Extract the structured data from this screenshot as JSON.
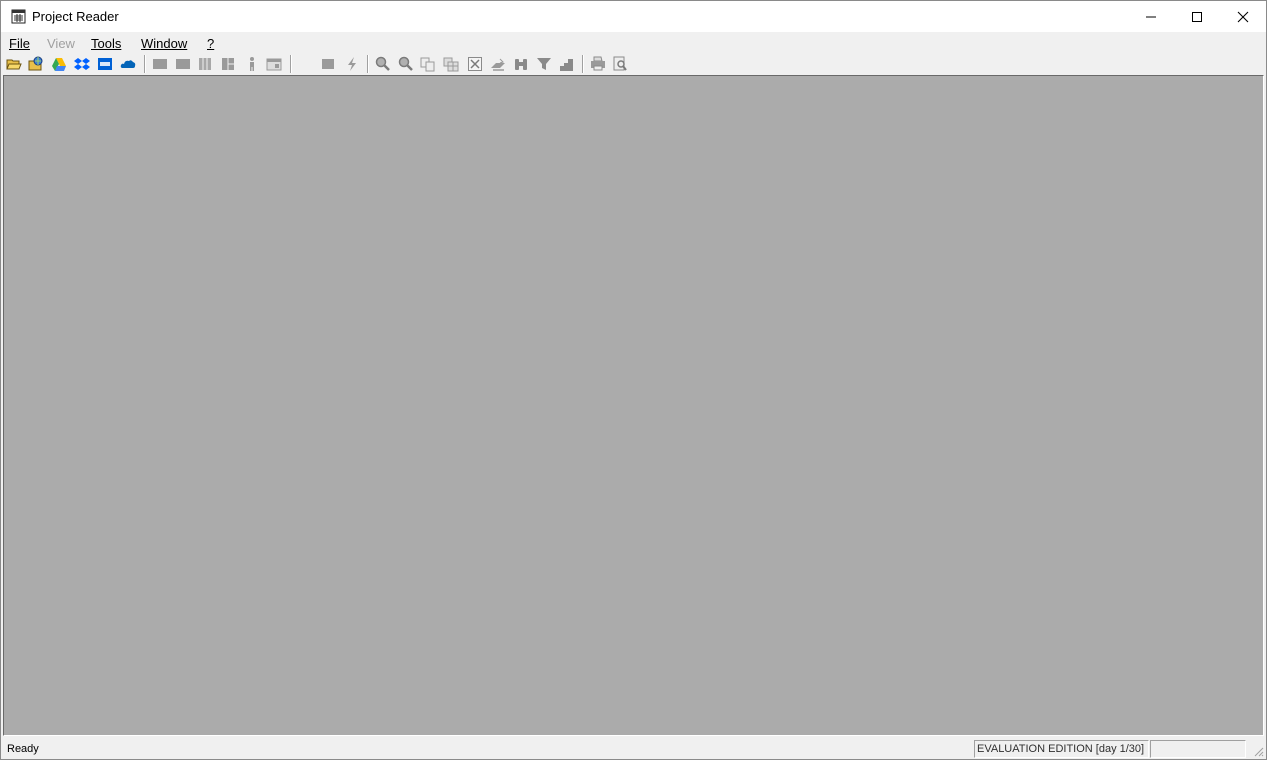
{
  "window": {
    "title": "Project Reader"
  },
  "menu": [
    {
      "label": "File",
      "enabled": true
    },
    {
      "label": "View",
      "enabled": false
    },
    {
      "label": "Tools",
      "enabled": true
    },
    {
      "label": "Window",
      "enabled": true
    },
    {
      "label": "?",
      "enabled": true
    }
  ],
  "toolbar_icons": [
    "open-folder-icon",
    "open-web-icon",
    "google-drive-icon",
    "dropbox-icon",
    "box-icon",
    "onedrive-icon",
    "view-gantt-icon",
    "view-tasks-icon",
    "view-columns-icon",
    "view-split-icon",
    "resources-icon",
    "calendar-icon",
    "stop-icon",
    "lightning-icon",
    "zoom-in-icon",
    "zoom-out-icon",
    "copy-icon",
    "table-icon",
    "close-box-icon",
    "link-icon",
    "binoculars-icon",
    "filter-icon",
    "chart-icon",
    "print-icon",
    "print-preview-icon"
  ],
  "status": {
    "text": "Ready",
    "edition": "EVALUATION EDITION  [day 1/30]"
  },
  "colors": {
    "client_bg": "#ababab",
    "chrome_bg": "#f0f0f0",
    "titlebar_bg": "#ffffff"
  }
}
